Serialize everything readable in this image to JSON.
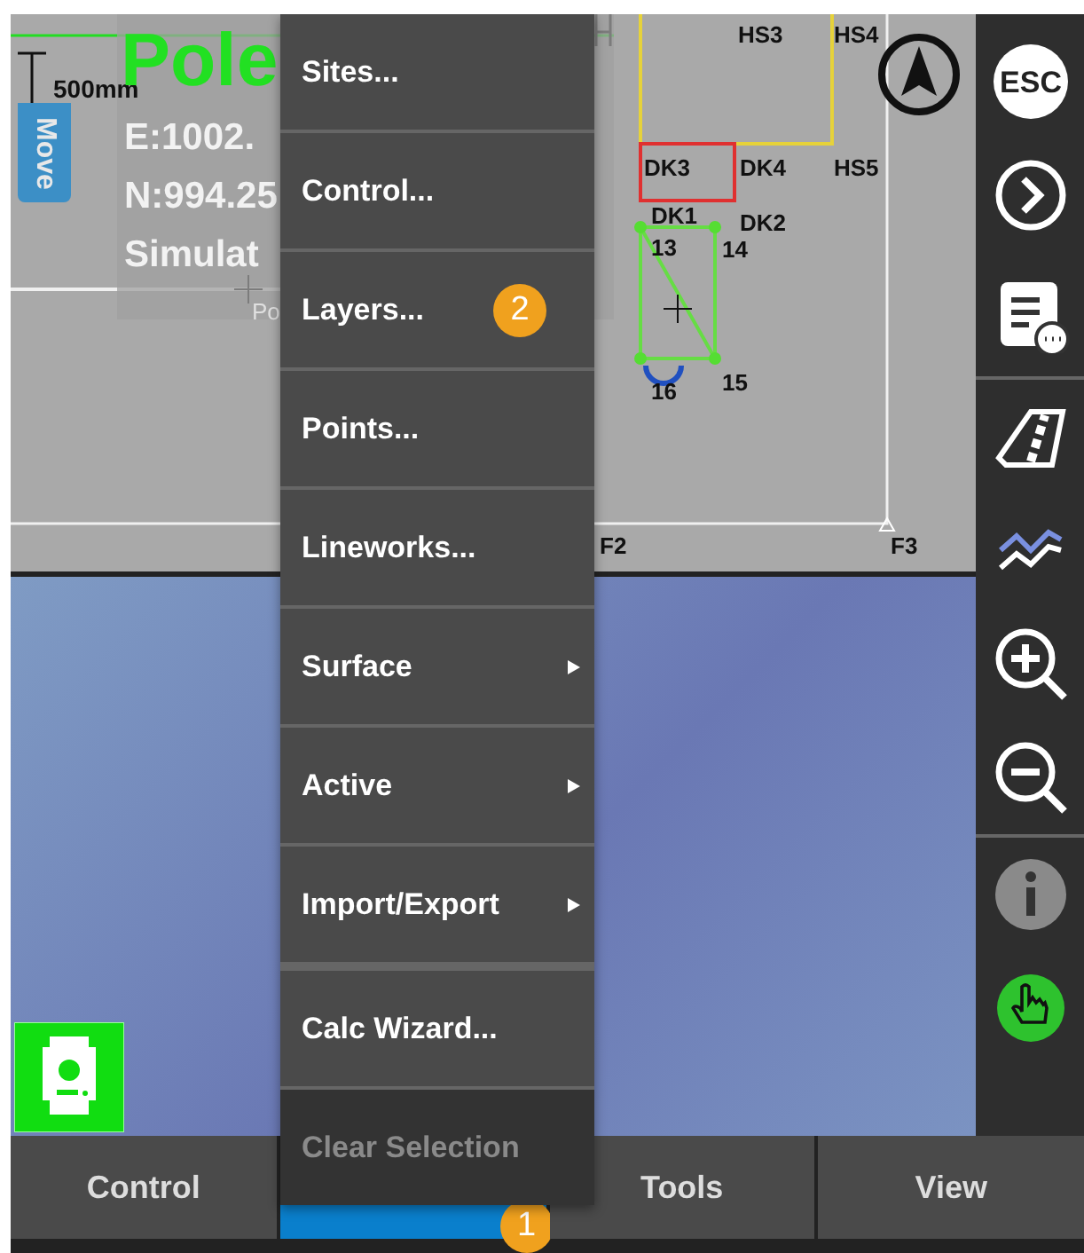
{
  "map": {
    "scale_label": "500mm",
    "move_tab": "Move",
    "title_left": "Pole",
    "readout": [
      "E:1002.",
      "N:994.25",
      "Simulat"
    ],
    "cursor_label": "Po",
    "labels": [
      "HS3",
      "HS4",
      "DK3",
      "DK4",
      "HS5",
      "DK1",
      "DK2",
      "13",
      "14",
      "16",
      "15",
      "F2",
      "F3"
    ]
  },
  "toolbar": [
    {
      "kind": "esc",
      "label": "ESC"
    },
    {
      "kind": "next"
    },
    {
      "kind": "notes"
    },
    {
      "kind": "road"
    },
    {
      "kind": "chart"
    },
    {
      "kind": "zoom_in"
    },
    {
      "kind": "zoom_out"
    },
    {
      "kind": "info"
    },
    {
      "kind": "hand"
    }
  ],
  "menu": {
    "items": [
      {
        "label": "Sites...",
        "submenu": false,
        "disabled": false
      },
      {
        "label": "Control...",
        "submenu": false,
        "disabled": false
      },
      {
        "label": "Layers...",
        "submenu": false,
        "disabled": false,
        "badge": "2"
      },
      {
        "label": "Points...",
        "submenu": false,
        "disabled": false
      },
      {
        "label": "Lineworks...",
        "submenu": false,
        "disabled": false
      },
      {
        "label": "Surface",
        "submenu": true,
        "disabled": false
      },
      {
        "label": "Active",
        "submenu": true,
        "disabled": false
      },
      {
        "label": "Import/Export",
        "submenu": true,
        "disabled": false
      },
      {
        "label": "Calc Wizard...",
        "submenu": false,
        "disabled": false
      },
      {
        "label": "Clear Selection",
        "submenu": false,
        "disabled": true
      }
    ]
  },
  "tabs": [
    {
      "label": "Control",
      "selected": false
    },
    {
      "selected": true,
      "badge": "1"
    },
    {
      "label": "Tools",
      "selected": false
    },
    {
      "label": "View",
      "selected": false
    }
  ]
}
